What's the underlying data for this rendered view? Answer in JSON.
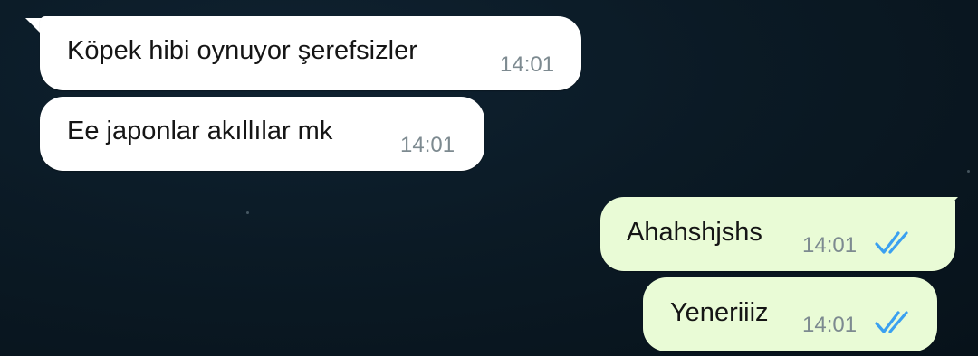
{
  "chat": {
    "messages": [
      {
        "direction": "incoming",
        "text": "Köpek hibi oynuyor şerefsizler",
        "time": "14:01"
      },
      {
        "direction": "incoming",
        "text": "Ee japonlar akıllılar mk",
        "time": "14:01"
      },
      {
        "direction": "outgoing",
        "text": "Ahahshjshs",
        "time": "14:01",
        "status": "read"
      },
      {
        "direction": "outgoing",
        "text": "Yeneriiiz",
        "time": "14:01",
        "status": "read"
      }
    ]
  },
  "colors": {
    "incoming_bubble": "#ffffff",
    "outgoing_bubble": "#e9fbd6",
    "read_ticks": "#3aa0f0",
    "timestamp": "#7d8a90",
    "background": "#0b1a25"
  },
  "icons": {
    "read_receipt": "double-check-icon"
  }
}
